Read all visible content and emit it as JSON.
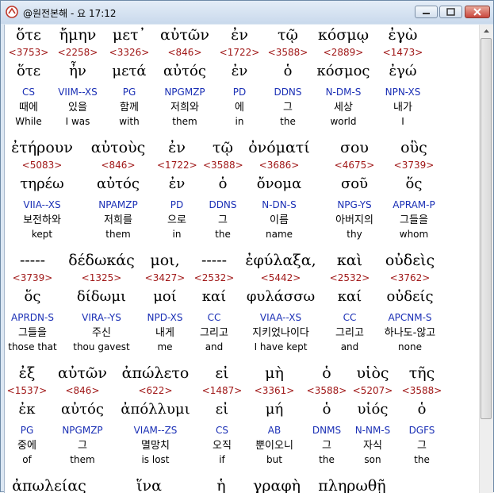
{
  "window": {
    "title": "@원전본해 - 요 17:12"
  },
  "rows": [
    {
      "words": [
        {
          "greek": "ὅτε",
          "strong": "<3753>",
          "lemma": "ὅτε",
          "parse": "CS",
          "korean": "때에",
          "english": "While"
        },
        {
          "greek": "ἤμην",
          "strong": "<2258>",
          "lemma": "ἦν",
          "parse": "VIIM--XS",
          "korean": "있을",
          "english": "I was"
        },
        {
          "greek": "μετ᾽",
          "strong": "<3326>",
          "lemma": "μετά",
          "parse": "PG",
          "korean": "함께",
          "english": "with"
        },
        {
          "greek": "αὐτῶν",
          "strong": "<846>",
          "lemma": "αὐτός",
          "parse": "NPGMZP",
          "korean": "저희와",
          "english": "them"
        },
        {
          "greek": "ἐν",
          "strong": "<1722>",
          "lemma": "ἐν",
          "parse": "PD",
          "korean": "에",
          "english": "in"
        },
        {
          "greek": "τῷ",
          "strong": "<3588>",
          "lemma": "ὁ",
          "parse": "DDNS",
          "korean": "그",
          "english": "the"
        },
        {
          "greek": "κόσμῳ",
          "strong": "<2889>",
          "lemma": "κόσμος",
          "parse": "N-DM-S",
          "korean": "세상",
          "english": "world"
        },
        {
          "greek": "ἐγὼ",
          "strong": "<1473>",
          "lemma": "ἐγώ",
          "parse": "NPN-XS",
          "korean": "내가",
          "english": "I"
        }
      ]
    },
    {
      "words": [
        {
          "greek": "ἐτήρουν",
          "strong": "<5083>",
          "lemma": "τηρέω",
          "parse": "VIIA--XS",
          "korean": "보전하와",
          "english": "kept"
        },
        {
          "greek": "αὐτοὺς",
          "strong": "<846>",
          "lemma": "αὐτός",
          "parse": "NPAMZP",
          "korean": "저희를",
          "english": "them"
        },
        {
          "greek": "ἐν",
          "strong": "<1722>",
          "lemma": "ἐν",
          "parse": "PD",
          "korean": "으로",
          "english": "in"
        },
        {
          "greek": "τῷ",
          "strong": "<3588>",
          "lemma": "ὁ",
          "parse": "DDNS",
          "korean": "그",
          "english": "the"
        },
        {
          "greek": "ὀνόματί",
          "strong": "<3686>",
          "lemma": "ὄνομα",
          "parse": "N-DN-S",
          "korean": "이름",
          "english": "name"
        },
        {
          "greek": "σου",
          "strong": "<4675>",
          "lemma": "σοῦ",
          "parse": "NPG-YS",
          "korean": "아버지의",
          "english": "thy"
        },
        {
          "greek": "οὓς",
          "strong": "<3739>",
          "lemma": "ὅς",
          "parse": "APRAM-P",
          "korean": "그들을",
          "english": "whom"
        }
      ]
    },
    {
      "words": [
        {
          "greek": "-----",
          "strong": "<3739>",
          "lemma": "ὅς",
          "parse": "APRDN-S",
          "korean": "그들을",
          "english": "those that"
        },
        {
          "greek": "δέδωκάς",
          "strong": "<1325>",
          "lemma": "δίδωμι",
          "parse": "VIRA--YS",
          "korean": "주신",
          "english": "thou gavest"
        },
        {
          "greek": "μοι,",
          "strong": "<3427>",
          "lemma": "μοί",
          "parse": "NPD-XS",
          "korean": "내게",
          "english": "me"
        },
        {
          "greek": "-----",
          "strong": "<2532>",
          "lemma": "καί",
          "parse": "CC",
          "korean": "그리고",
          "english": "and"
        },
        {
          "greek": "ἐφύλαξα,",
          "strong": "<5442>",
          "lemma": "φυλάσσω",
          "parse": "VIAA--XS",
          "korean": "지키었나이다",
          "english": "I have kept"
        },
        {
          "greek": "καὶ",
          "strong": "<2532>",
          "lemma": "καί",
          "parse": "CC",
          "korean": "그리고",
          "english": "and"
        },
        {
          "greek": "οὐδεὶς",
          "strong": "<3762>",
          "lemma": "οὐδείς",
          "parse": "APCNM-S",
          "korean": "하나도-않고",
          "english": "none"
        }
      ]
    },
    {
      "words": [
        {
          "greek": "ἐξ",
          "strong": "<1537>",
          "lemma": "ἐκ",
          "parse": "PG",
          "korean": "중에",
          "english": "of"
        },
        {
          "greek": "αὐτῶν",
          "strong": "<846>",
          "lemma": "αὐτός",
          "parse": "NPGMZP",
          "korean": "그",
          "english": "them"
        },
        {
          "greek": "ἀπώλετο",
          "strong": "<622>",
          "lemma": "ἀπόλλυμι",
          "parse": "VIAM--ZS",
          "korean": "멸망치",
          "english": "is lost"
        },
        {
          "greek": "εἰ",
          "strong": "<1487>",
          "lemma": "εἰ",
          "parse": "CS",
          "korean": "오직",
          "english": "if"
        },
        {
          "greek": "μὴ",
          "strong": "<3361>",
          "lemma": "μή",
          "parse": "AB",
          "korean": "뿐이오니",
          "english": "but"
        },
        {
          "greek": "ὁ",
          "strong": "<3588>",
          "lemma": "ὁ",
          "parse": "DNMS",
          "korean": "그",
          "english": "the"
        },
        {
          "greek": "υἱὸς",
          "strong": "<5207>",
          "lemma": "υἱός",
          "parse": "N-NM-S",
          "korean": "자식",
          "english": "son"
        },
        {
          "greek": "τῆς",
          "strong": "<3588>",
          "lemma": "ὁ",
          "parse": "DGFS",
          "korean": "그",
          "english": "the"
        }
      ]
    },
    {
      "words": [
        {
          "greek": "ἀπωλείας",
          "strong": "",
          "lemma": "",
          "parse": "",
          "korean": "",
          "english": ""
        },
        {
          "greek": "ἵνα",
          "strong": "",
          "lemma": "",
          "parse": "",
          "korean": "",
          "english": ""
        },
        {
          "greek": "ἡ",
          "strong": "",
          "lemma": "",
          "parse": "",
          "korean": "",
          "english": ""
        },
        {
          "greek": "γραφὴ",
          "strong": "",
          "lemma": "",
          "parse": "",
          "korean": "",
          "english": ""
        },
        {
          "greek": "πληρωθῇ",
          "strong": "",
          "lemma": "",
          "parse": "",
          "korean": "",
          "english": ""
        }
      ]
    }
  ]
}
